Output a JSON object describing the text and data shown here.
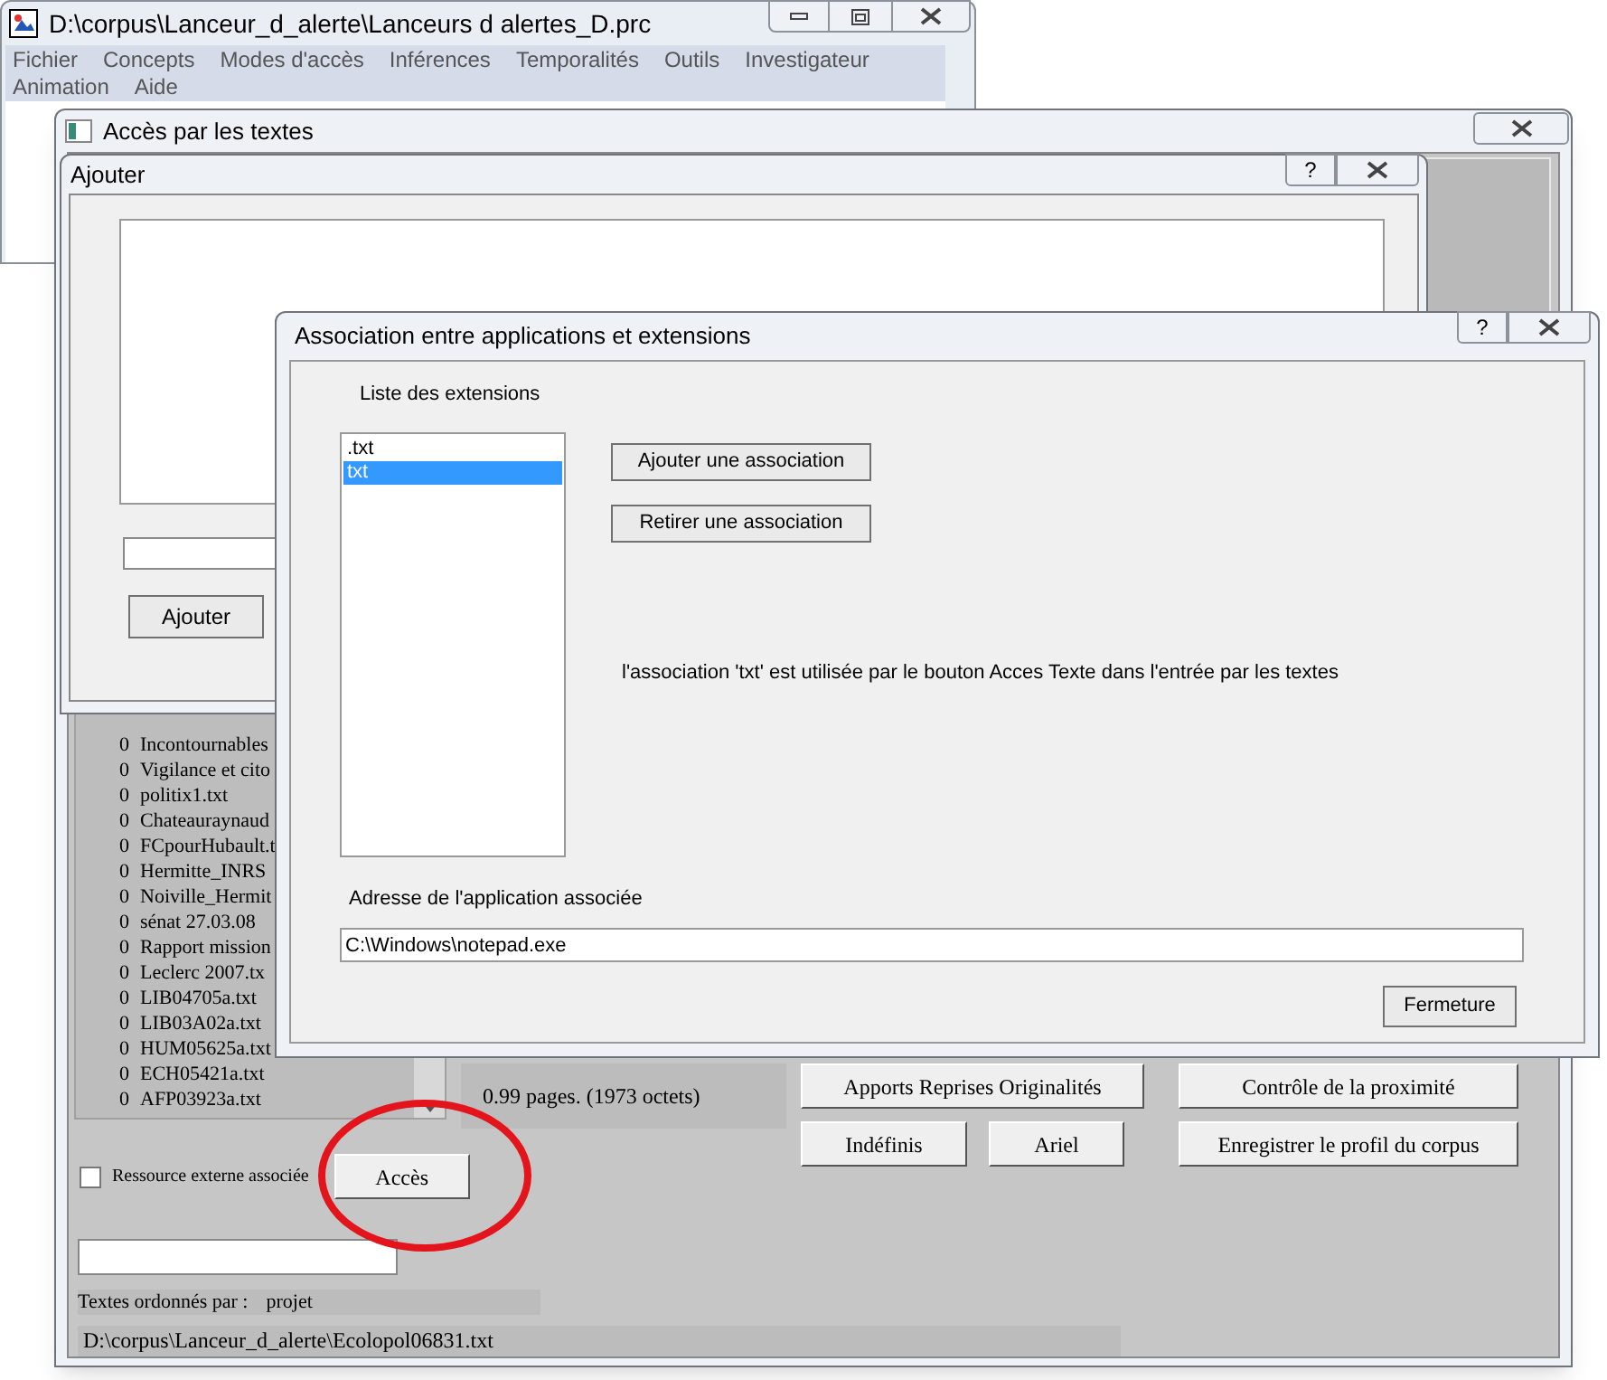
{
  "main_window": {
    "title": "D:\\corpus\\Lanceur_d_alerte\\Lanceurs d alertes_D.prc",
    "menu": [
      "Fichier",
      "Concepts",
      "Modes d'accès",
      "Inférences",
      "Temporalités",
      "Outils",
      "Investigateur",
      "Animation",
      "Aide"
    ]
  },
  "texts_window": {
    "title": "Accès par les textes",
    "files": [
      {
        "count": "0",
        "name": "Incontournables"
      },
      {
        "count": "0",
        "name": "Vigilance et cito"
      },
      {
        "count": "0",
        "name": "politix1.txt"
      },
      {
        "count": "0",
        "name": "Chateauraynaud"
      },
      {
        "count": "0",
        "name": "FCpourHubault.t"
      },
      {
        "count": "0",
        "name": "Hermitte_INRS"
      },
      {
        "count": "0",
        "name": "Noiville_Hermit"
      },
      {
        "count": "0",
        "name": "sénat 27.03.08"
      },
      {
        "count": "0",
        "name": "Rapport mission"
      },
      {
        "count": "0",
        "name": "Leclerc 2007.tx"
      },
      {
        "count": "0",
        "name": "LIB04705a.txt"
      },
      {
        "count": "0",
        "name": "LIB03A02a.txt"
      },
      {
        "count": "0",
        "name": "HUM05625a.txt"
      },
      {
        "count": "0",
        "name": "ECH05421a.txt"
      },
      {
        "count": "0",
        "name": "AFP03923a.txt"
      }
    ],
    "page_info": "0.99 pages. (1973 octets)",
    "buttons": [
      "Apports Reprises Originalités",
      "Contrôle de la proximité",
      "Indéfinis",
      "Ariel",
      "Enregistrer le profil du corpus"
    ],
    "external_resource": {
      "label": "Ressource externe associée",
      "checked": false
    },
    "access_button": "Accès",
    "order_label": "Textes ordonnés par :",
    "order_value": "projet",
    "path": "D:\\corpus\\Lanceur_d_alerte\\Ecolopol06831.txt"
  },
  "add_dialog": {
    "title": "Ajouter",
    "help": "?",
    "button": "Ajouter"
  },
  "association_dialog": {
    "title": "Association entre applications et extensions",
    "help": "?",
    "list_label": "Liste des extensions",
    "extensions": [
      {
        "label": ".txt",
        "selected": false
      },
      {
        "label": "txt",
        "selected": true
      }
    ],
    "buttons": [
      "Ajouter une association",
      "Retirer une association"
    ],
    "message": "l'association 'txt' est utilisée par le bouton Acces Texte dans l'entrée par les textes",
    "address_label": "Adresse de l'application associée",
    "address_value": "C:\\Windows\\notepad.exe",
    "close_button": "Fermeture"
  }
}
